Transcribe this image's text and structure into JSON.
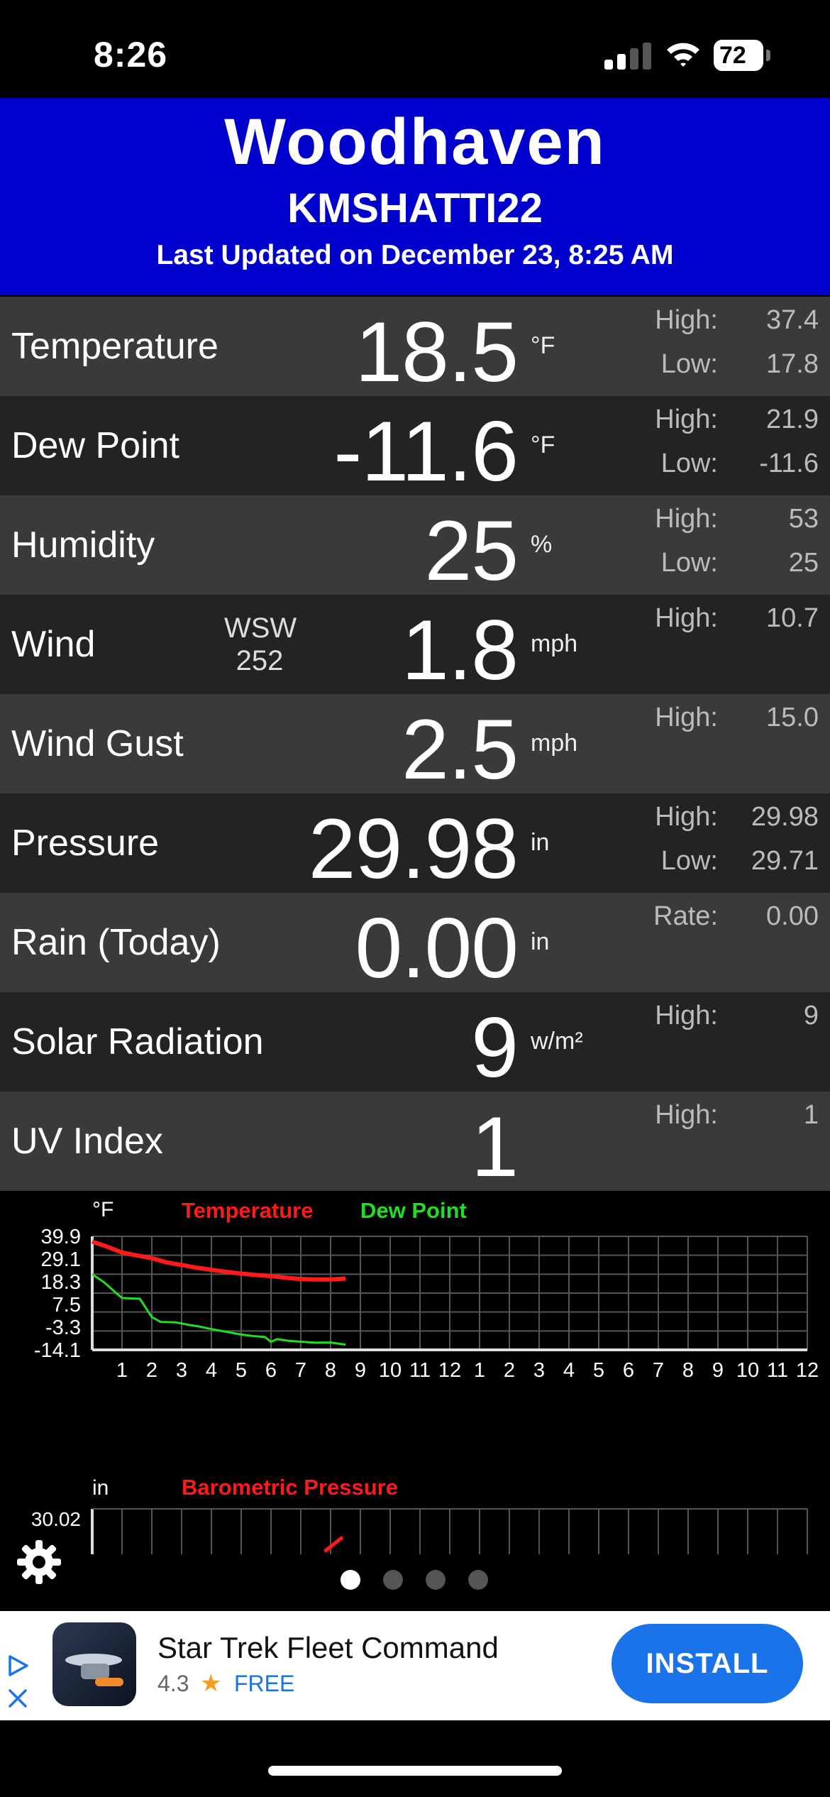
{
  "status_bar": {
    "time": "8:26",
    "battery": "72"
  },
  "header": {
    "station_name": "Woodhaven",
    "station_id": "KMSHATTI22",
    "last_updated": "Last Updated on December 23, 8:25 AM"
  },
  "rows": [
    {
      "label": "Temperature",
      "value": "18.5",
      "unit": "°F",
      "k1": "High:",
      "v1": "37.4",
      "k2": "Low:",
      "v2": "17.8"
    },
    {
      "label": "Dew Point",
      "value": "-11.6",
      "unit": "°F",
      "k1": "High:",
      "v1": "21.9",
      "k2": "Low:",
      "v2": "-11.6"
    },
    {
      "label": "Humidity",
      "value": "25",
      "unit": "%",
      "k1": "High:",
      "v1": "53",
      "k2": "Low:",
      "v2": "25"
    },
    {
      "label": "Wind",
      "value": "1.8",
      "unit": "mph",
      "dir": "WSW",
      "deg": "252",
      "k1": "High:",
      "v1": "10.7"
    },
    {
      "label": "Wind Gust",
      "value": "2.5",
      "unit": "mph",
      "k1": "High:",
      "v1": "15.0"
    },
    {
      "label": "Pressure",
      "value": "29.98",
      "unit": "in",
      "k1": "High:",
      "v1": "29.98",
      "k2": "Low:",
      "v2": "29.71"
    },
    {
      "label": "Rain (Today)",
      "value": "0.00",
      "unit": "in",
      "k1": "Rate:",
      "v1": "0.00"
    },
    {
      "label": "Solar Radiation",
      "value": "9",
      "unit": "w/m²",
      "k1": "High:",
      "v1": "9"
    },
    {
      "label": "UV Index",
      "value": "1",
      "unit": "",
      "k1": "High:",
      "v1": "1"
    }
  ],
  "chart_data": [
    {
      "type": "line",
      "unit_label": "°F",
      "y_ticks": [
        "39.9",
        "29.1",
        "18.3",
        "7.5",
        "-3.3",
        "-14.1"
      ],
      "ylim": [
        -14.1,
        39.9
      ],
      "x_ticks": [
        "1",
        "2",
        "3",
        "4",
        "5",
        "6",
        "7",
        "8",
        "9",
        "10",
        "11",
        "12",
        "1",
        "2",
        "3",
        "4",
        "5",
        "6",
        "7",
        "8",
        "9",
        "10",
        "11",
        "12"
      ],
      "grid": true,
      "series": [
        {
          "name": "Temperature",
          "color": "#ff1a1a",
          "x": [
            0.0,
            0.5,
            1.0,
            1.5,
            2.0,
            2.5,
            3.0,
            3.5,
            4.0,
            4.5,
            5.0,
            5.5,
            6.0,
            6.5,
            7.0,
            7.5,
            8.0,
            8.5
          ],
          "y": [
            37.4,
            35.0,
            32.2,
            30.8,
            29.5,
            27.5,
            26.3,
            25.0,
            24.0,
            23.0,
            22.2,
            21.5,
            21.0,
            20.2,
            19.6,
            19.4,
            19.4,
            19.8
          ]
        },
        {
          "name": "Dew Point",
          "color": "#22dd22",
          "x": [
            0.0,
            0.4,
            0.8,
            1.0,
            1.6,
            2.0,
            2.3,
            2.8,
            3.2,
            3.6,
            4.0,
            4.5,
            5.0,
            5.4,
            5.8,
            6.0,
            6.2,
            6.6,
            7.0,
            7.5,
            8.0,
            8.5
          ],
          "y": [
            21.9,
            18.0,
            13.0,
            10.6,
            10.2,
            1.5,
            -0.8,
            -1.0,
            -2.1,
            -3.0,
            -4.2,
            -5.5,
            -6.8,
            -7.5,
            -8.0,
            -10.3,
            -9.0,
            -9.8,
            -10.2,
            -10.7,
            -10.6,
            -11.6
          ]
        }
      ]
    },
    {
      "type": "line",
      "unit_label": "in",
      "title": "Barometric Pressure",
      "y_ticks": [
        "30.02"
      ],
      "grid": true,
      "series": [
        {
          "name": "Barometric Pressure",
          "color": "#ff1a1a",
          "x": [
            7.8,
            8.1,
            8.4
          ],
          "y": [
            29.96,
            29.97,
            29.98
          ]
        }
      ]
    }
  ],
  "pager": {
    "count": 4,
    "active": 0
  },
  "ad": {
    "title": "Star Trek Fleet Command",
    "rating": "4.3",
    "star": "★",
    "price": "FREE",
    "install_label": "INSTALL"
  }
}
